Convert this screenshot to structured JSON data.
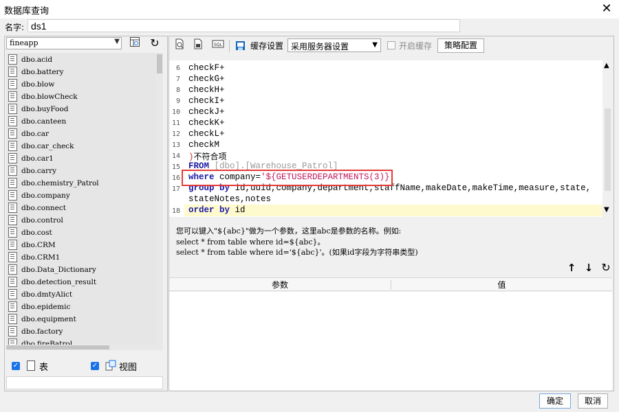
{
  "window": {
    "title": "数据库查询"
  },
  "name": {
    "label": "名字:",
    "value": "ds1"
  },
  "left": {
    "database": "fineapp",
    "tables": [
      "dbo.acid",
      "dbo.battery",
      "dbo.blow",
      "dbo.blowCheck",
      "dbo.buyFood",
      "dbo.canteen",
      "dbo.car",
      "dbo.car_check",
      "dbo.car1",
      "dbo.carry",
      "dbo.chemistry_Patrol",
      "dbo.company",
      "dbo.connect",
      "dbo.control",
      "dbo.cost",
      "dbo.CRM",
      "dbo.CRM1",
      "dbo.Data_Dictionary",
      "dbo.detection_result",
      "dbo.dmtyAlict",
      "dbo.epidemic",
      "dbo.equipment",
      "dbo.factory",
      "dbo.fireBatrol"
    ],
    "show_tables_label": "表",
    "show_views_label": "视图"
  },
  "toolbar": {
    "cache_label": "缓存设置",
    "cache_value": "采用服务器设置",
    "enable_cache_label": "开启缓存",
    "policy_label": "策略配置"
  },
  "editor": {
    "line_numbers": [
      "6",
      "7",
      "8",
      "9",
      "10",
      "11",
      "12",
      "13",
      "14",
      "15",
      "16",
      "17",
      "",
      "18"
    ],
    "lines": {
      "l6": "checkF+",
      "l7": "checkG+",
      "l8": "checkH+",
      "l9": "checkI+",
      "l10": "checkJ+",
      "l11": "checkK+",
      "l12": "checkL+",
      "l13": "checkM",
      "l14_paren": ")",
      "l14_text": "不符合项",
      "l15_kw": "FROM",
      "l15_rest": " [dbo].[Warehouse_Patrol]",
      "l16_kw": "where",
      "l16_mid": " company=",
      "l16_str": "'${GETUSERDEPARTMENTS(3)}'",
      "l17_kw": "group by",
      "l17_rest": " id,uuid,company,department,staffName,makeDate,makeTime,measure,state,",
      "l17b": "stateNotes,notes",
      "l18_kw": "order by",
      "l18_rest": " id"
    }
  },
  "hint": {
    "line1": "您可以键入\"${abc}\"做为一个参数，这里abc是参数的名称。例如:",
    "line2": "select * from table where id=${abc}。",
    "line3": "select * from table where id='${abc}'。(如果id字段为字符串类型)"
  },
  "params": {
    "col_param": "参数",
    "col_value": "值"
  },
  "footer": {
    "ok": "确定",
    "cancel": "取消"
  }
}
